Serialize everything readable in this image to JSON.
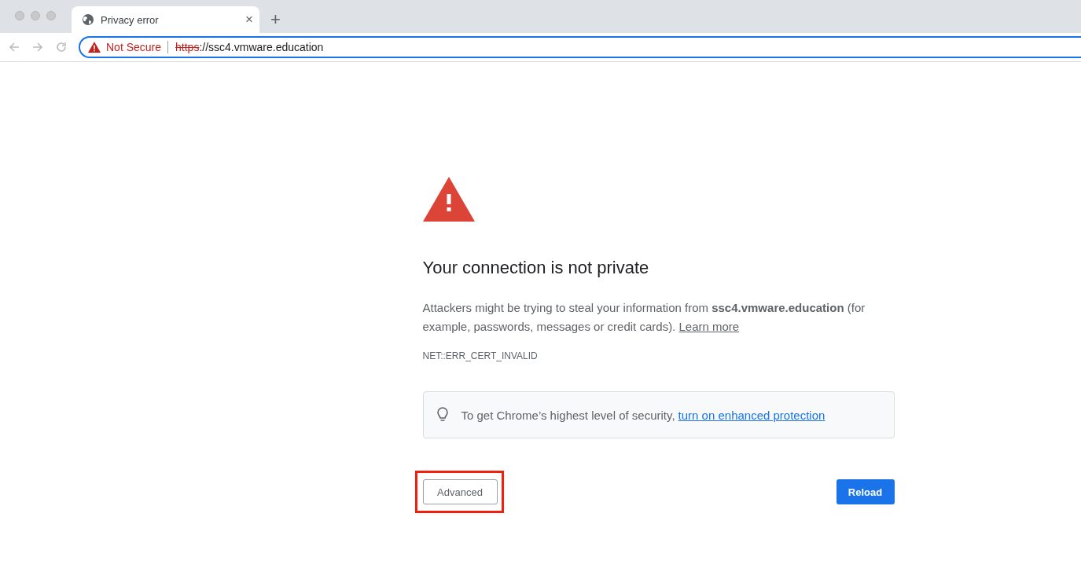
{
  "tab": {
    "title": "Privacy error",
    "close": "×",
    "new_tab": "+"
  },
  "address_bar": {
    "security_label": "Not Secure",
    "scheme": "https",
    "rest": "://ssc4.vmware.education"
  },
  "page": {
    "heading": "Your connection is not private",
    "message": "Attackers might be trying to steal your information from **ssc4.vmware.education** (for example, passwords, messages or credit cards).",
    "learn_more": "Learn more",
    "error_code": "NET::ERR_CERT_INVALID",
    "tip": {
      "text": "To get Chrome’s highest level of security,",
      "link": "turn on enhanced protection"
    },
    "advanced_button": {
      "label": "Advanced",
      "highlighted": true
    },
    "reload_button": {
      "label": "Reload"
    }
  }
}
